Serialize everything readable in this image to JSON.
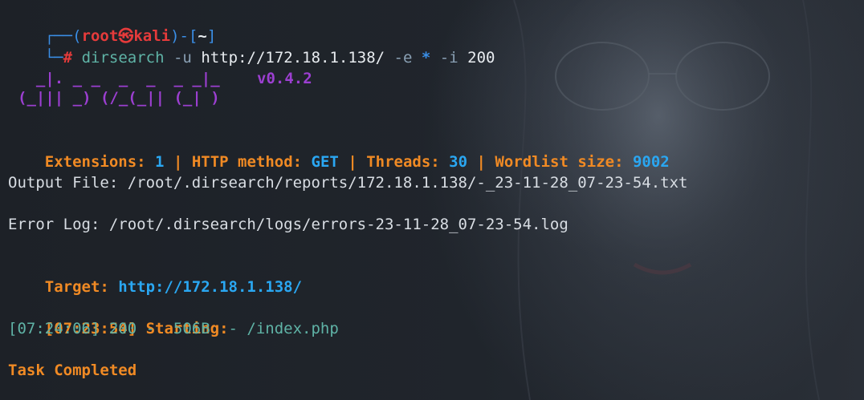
{
  "prompt": {
    "corner_top": "┌──(",
    "user": "root",
    "at_symbol": "㉿",
    "host": "kali",
    "close_paren": ")-[",
    "cwd": "~",
    "close_bracket": "]",
    "corner_bottom": "└─",
    "hash": "#"
  },
  "command": {
    "program": "dirsearch",
    "flag_u": "-u",
    "url": "http://172.18.1.138/",
    "flag_e": "-e",
    "star": "*",
    "flag_i": "-i",
    "status": "200"
  },
  "banner": {
    "art_line1": "  _|. _ _  _  _  _ _|_",
    "art_line2": "(_||| _) (/_(_|| (_| )",
    "version": "v0.4.2"
  },
  "config": {
    "extensions_label": "Extensions: ",
    "extensions_value": "1",
    "sep1": " | ",
    "method_label": "HTTP method: ",
    "method_value": "GET",
    "sep2": " | ",
    "threads_label": "Threads: ",
    "threads_value": "30",
    "sep3": " | ",
    "wordlist_label": "Wordlist size: ",
    "wordlist_value": "9002"
  },
  "output_file": "Output File: /root/.dirsearch/reports/172.18.1.138/-_23-11-28_07-23-54.txt",
  "error_log": "Error Log: /root/.dirsearch/logs/errors-23-11-28_07-23-54.log",
  "target": {
    "label": "Target: ",
    "url": "http://172.18.1.138/"
  },
  "starting": {
    "time": "[07:23:54]",
    "label": " Starting:"
  },
  "result": {
    "line": "[07:24:06] 200 -  506B  - /index.php"
  },
  "completed": "Task Completed",
  "colors": {
    "background": "#1f2329",
    "prompt_blue": "#3a8ee6",
    "prompt_red": "#e63b3b",
    "orange": "#f08a24",
    "cyan": "#2aa7f2",
    "purple": "#9c3fd1",
    "teal": "#5fb3a6"
  }
}
